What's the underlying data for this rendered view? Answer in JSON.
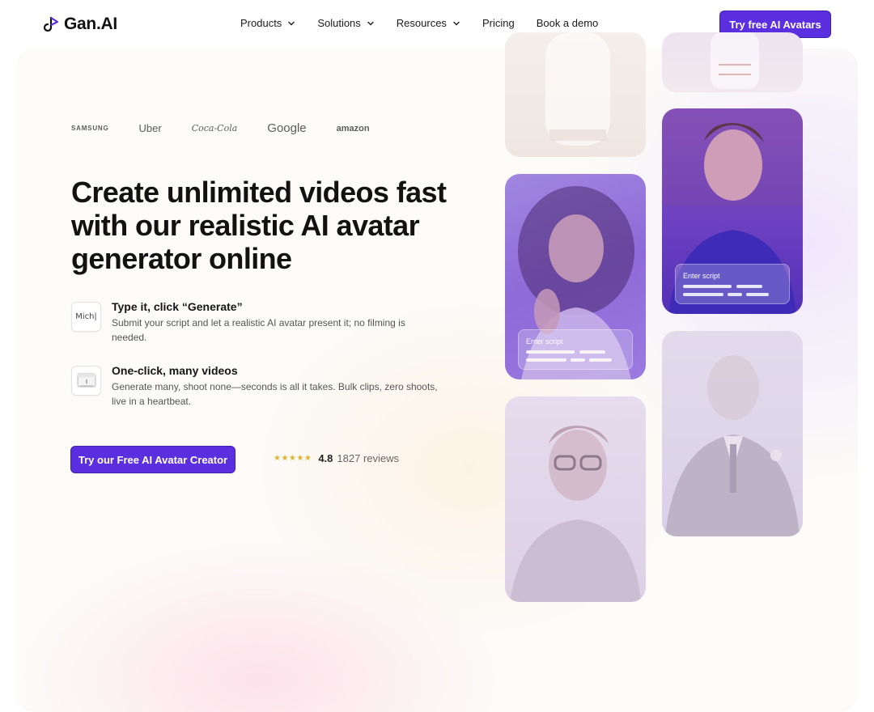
{
  "brand": {
    "name": "Gan.AI",
    "accent": "#5b2ee0"
  },
  "nav": {
    "items": [
      {
        "label": "Products",
        "dropdown": true
      },
      {
        "label": "Solutions",
        "dropdown": true
      },
      {
        "label": "Resources",
        "dropdown": true
      },
      {
        "label": "Pricing",
        "dropdown": false
      },
      {
        "label": "Book a demo",
        "dropdown": false
      }
    ],
    "cta_label": "Try free AI Avatars"
  },
  "logos": [
    "SAMSUNG",
    "Uber",
    "Coca-Cola",
    "Google",
    "amazon"
  ],
  "hero": {
    "headline": "Create unlimited videos fast with our realistic AI avatar generator online",
    "features": [
      {
        "icon": "typing-icon",
        "icon_text": "Mich|",
        "title": "Type it, click “Generate”",
        "description": "Submit your script and let a realistic AI avatar present it; no filming is needed."
      },
      {
        "icon": "video-window-icon",
        "title": "One-click, many videos",
        "description": "Generate many, shoot none—seconds is all it takes. Bulk clips, zero shoots, live in a heartbeat."
      }
    ],
    "cta_label": "Try our Free AI Avatar Creator",
    "rating": {
      "stars": "★★★★★",
      "score": "4.8",
      "count": "1827 reviews"
    }
  },
  "avatars": {
    "script_label": "Enter script"
  }
}
